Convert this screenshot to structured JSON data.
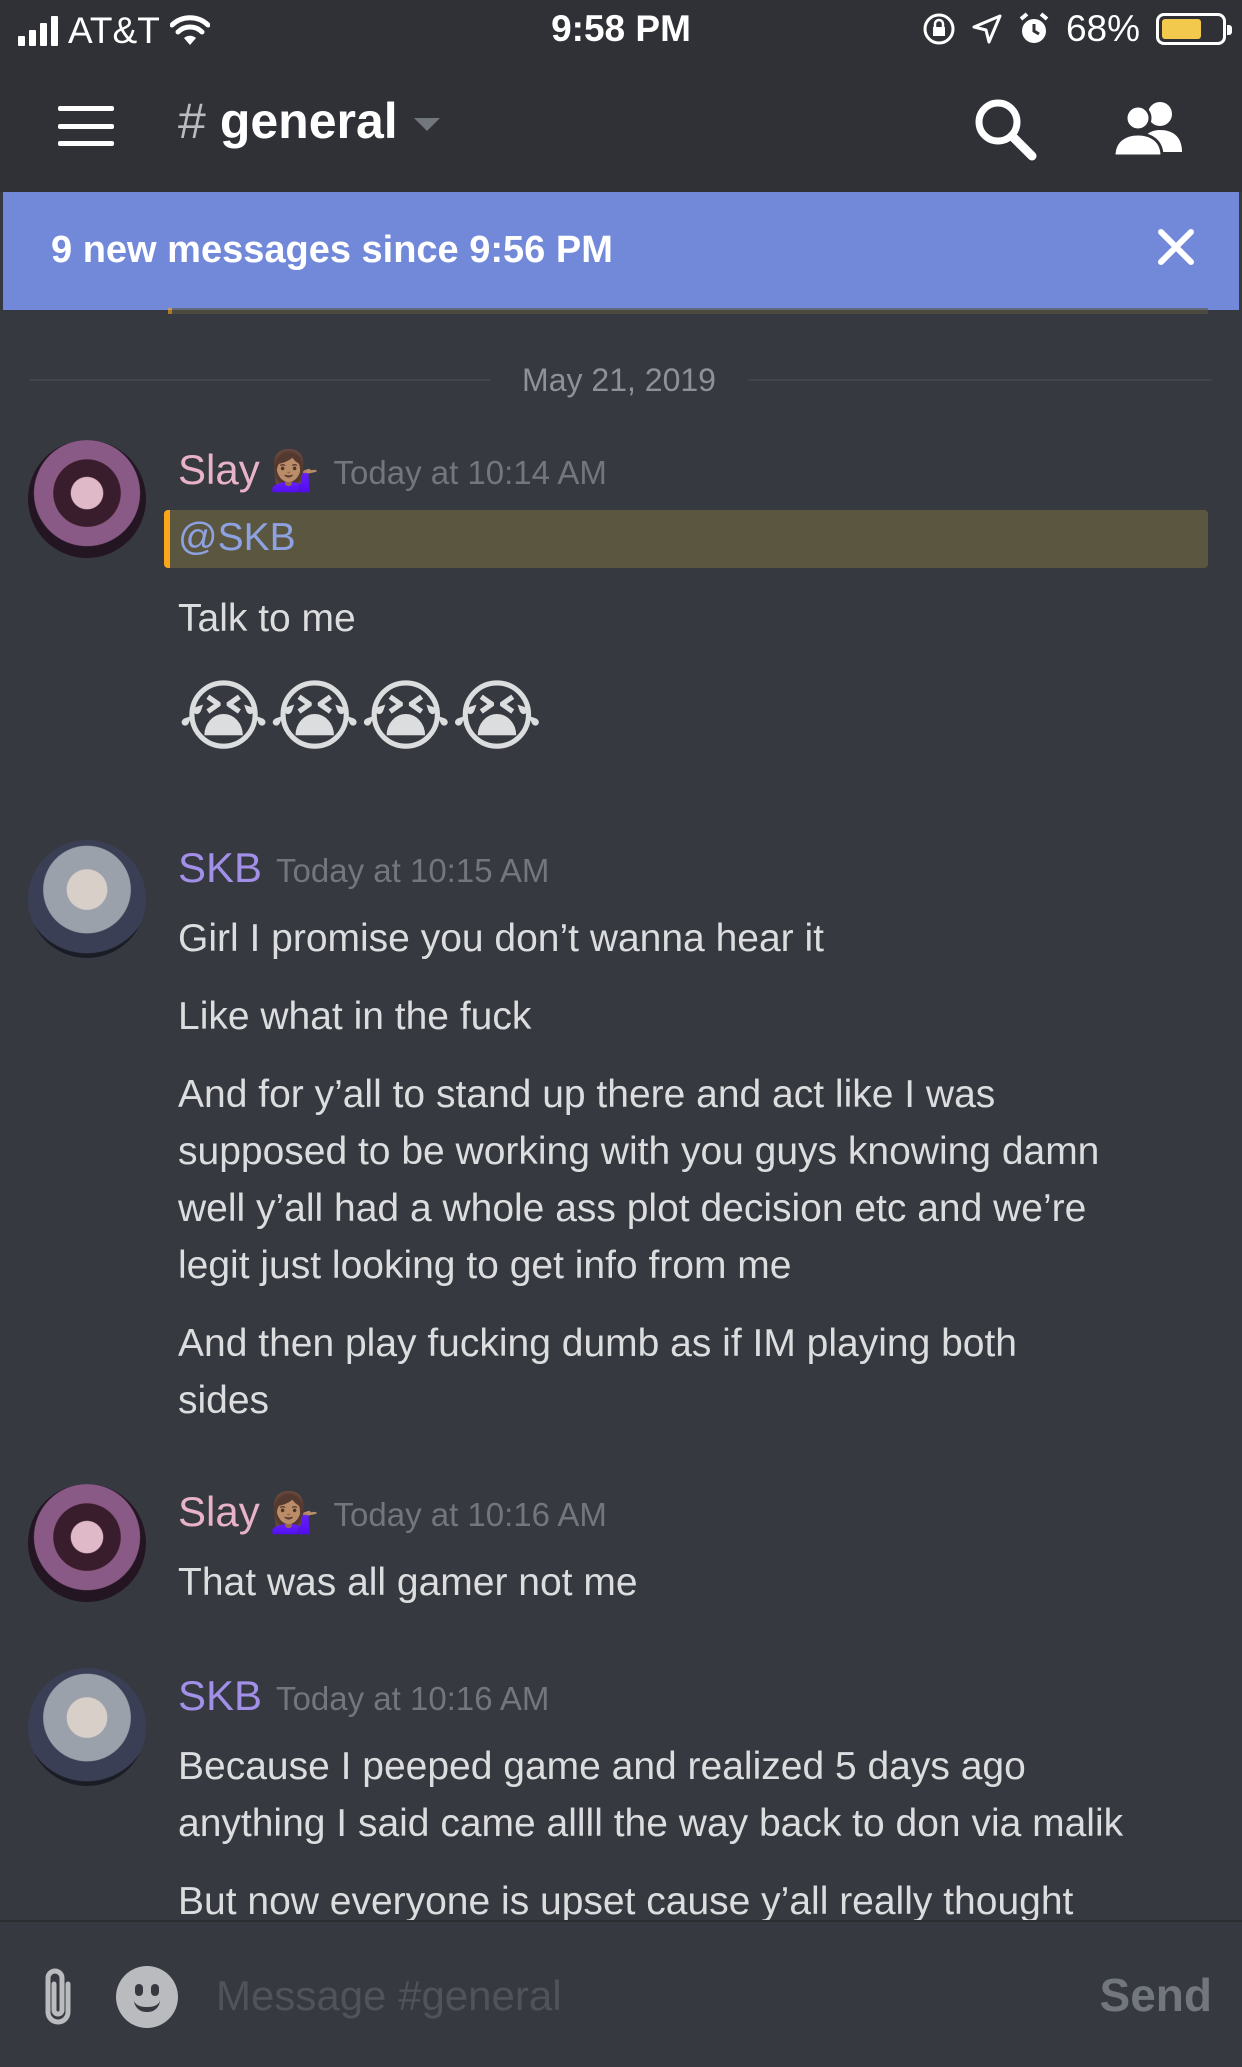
{
  "status": {
    "carrier": "AT&T",
    "time": "9:58 PM",
    "battery": "68%",
    "battery_level": 0.68
  },
  "header": {
    "hash": "#",
    "channel": "general"
  },
  "new_messages": {
    "text": "9 new messages since 9:56 PM"
  },
  "divider": {
    "date": "May 21, 2019"
  },
  "messages": [
    {
      "user": "Slay",
      "user_emoji": "💁🏽‍♀️",
      "time": "Today at 10:14 AM",
      "mention": "@SKB",
      "lines": [
        "Talk to me"
      ],
      "emojis": "😭😭😭😭"
    },
    {
      "user": "SKB",
      "time": "Today at 10:15 AM",
      "lines": [
        "Girl I promise you don’t wanna hear it",
        "Like what in the fuck",
        "And for y’all to stand up there and act like I was",
        "supposed to be working with you guys knowing damn",
        "well y’all had a whole ass plot decision etc and we’re",
        "legit just looking to get info from me",
        "And then play fucking dumb as if IM playing both",
        "sides"
      ]
    },
    {
      "user": "Slay",
      "user_emoji": "💁🏽‍♀️",
      "time": "Today at 10:16 AM",
      "lines": [
        "That was all gamer not me"
      ]
    },
    {
      "user": "SKB",
      "time": "Today at 10:16 AM",
      "lines": [
        "Because I peeped game and realized 5 days ago",
        "anything I said came allll the way back to don via malik",
        "But now everyone is upset cause y’all really thought"
      ]
    }
  ],
  "composer": {
    "placeholder": "Message #general",
    "send_label": "Send"
  },
  "colors": {
    "background": "#36393f",
    "header": "#2f3136",
    "blurple": "#7289da",
    "mention_bar": "#faa61a",
    "slay_name": "#e8b3c8",
    "skb_name": "#a18fe8"
  },
  "icons": [
    "signal-icon",
    "wifi-icon",
    "orientation-lock-icon",
    "location-icon",
    "alarm-icon",
    "battery-icon",
    "menu-icon",
    "search-icon",
    "members-icon",
    "close-icon",
    "attach-icon",
    "emoji-icon"
  ]
}
